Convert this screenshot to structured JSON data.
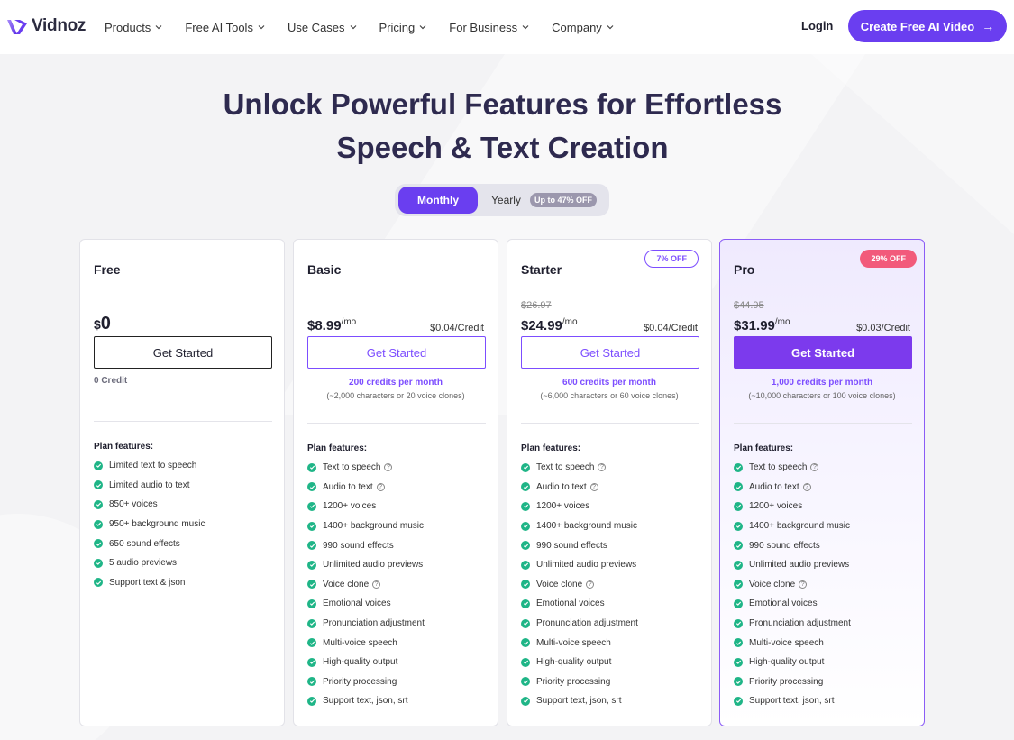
{
  "header": {
    "logo_text": "Vidnoz",
    "nav": [
      "Products",
      "Free AI Tools",
      "Use Cases",
      "Pricing",
      "For Business",
      "Company"
    ],
    "login": "Login",
    "cta": "Create Free AI Video"
  },
  "hero": {
    "title_line1": "Unlock Powerful Features for Effortless",
    "title_line2": "Speech & Text Creation"
  },
  "billing_toggle": {
    "monthly": "Monthly",
    "yearly": "Yearly",
    "yearly_badge": "Up to 47% OFF",
    "selected": "Monthly"
  },
  "plans": [
    {
      "name": "Free",
      "currency": "$",
      "price": "0",
      "button": "Get Started",
      "credit_note": "0 Credit",
      "features_label": "Plan features:",
      "features": [
        {
          "text": "Limited text to speech",
          "help": false
        },
        {
          "text": "Limited audio to text",
          "help": false
        },
        {
          "text": "850+ voices",
          "help": false
        },
        {
          "text": "950+ background music",
          "help": false
        },
        {
          "text": "650 sound effects",
          "help": false
        },
        {
          "text": "5 audio previews",
          "help": false
        },
        {
          "text": "Support text & json",
          "help": false
        }
      ]
    },
    {
      "name": "Basic",
      "price": "$8.99",
      "per": "/mo",
      "credit_rate": "$0.04/Credit",
      "button": "Get Started",
      "credits_main": "200 credits per month",
      "credits_sub": "(~2,000 characters or 20 voice clones)",
      "features_label": "Plan features:",
      "features": [
        {
          "text": "Text to speech",
          "help": true
        },
        {
          "text": "Audio to text",
          "help": true
        },
        {
          "text": "1200+ voices",
          "help": false
        },
        {
          "text": "1400+ background music",
          "help": false
        },
        {
          "text": "990 sound effects",
          "help": false
        },
        {
          "text": "Unlimited audio previews",
          "help": false
        },
        {
          "text": "Voice clone",
          "help": true
        },
        {
          "text": "Emotional voices",
          "help": false
        },
        {
          "text": "Pronunciation adjustment",
          "help": false
        },
        {
          "text": "Multi-voice speech",
          "help": false
        },
        {
          "text": "High-quality output",
          "help": false
        },
        {
          "text": "Priority processing",
          "help": false
        },
        {
          "text": "Support text, json, srt",
          "help": false
        }
      ]
    },
    {
      "name": "Starter",
      "badge": "7% OFF",
      "old_price": "$26.97",
      "price": "$24.99",
      "per": "/mo",
      "credit_rate": "$0.04/Credit",
      "button": "Get Started",
      "credits_main": "600 credits per month",
      "credits_sub": "(~6,000 characters or 60 voice clones)",
      "features_label": "Plan features:",
      "features": [
        {
          "text": "Text to speech",
          "help": true
        },
        {
          "text": "Audio to text",
          "help": true
        },
        {
          "text": "1200+ voices",
          "help": false
        },
        {
          "text": "1400+ background music",
          "help": false
        },
        {
          "text": "990 sound effects",
          "help": false
        },
        {
          "text": "Unlimited audio previews",
          "help": false
        },
        {
          "text": "Voice clone",
          "help": true
        },
        {
          "text": "Emotional voices",
          "help": false
        },
        {
          "text": "Pronunciation adjustment",
          "help": false
        },
        {
          "text": "Multi-voice speech",
          "help": false
        },
        {
          "text": "High-quality output",
          "help": false
        },
        {
          "text": "Priority processing",
          "help": false
        },
        {
          "text": "Support text, json, srt",
          "help": false
        }
      ]
    },
    {
      "name": "Pro",
      "badge": "29% OFF",
      "old_price": "$44.95",
      "price": "$31.99",
      "per": "/mo",
      "credit_rate": "$0.03/Credit",
      "button": "Get Started",
      "credits_main": "1,000 credits per month",
      "credits_sub": "(~10,000 characters or 100 voice clones)",
      "features_label": "Plan features:",
      "features": [
        {
          "text": "Text to speech",
          "help": true
        },
        {
          "text": "Audio to text",
          "help": true
        },
        {
          "text": "1200+ voices",
          "help": false
        },
        {
          "text": "1400+ background music",
          "help": false
        },
        {
          "text": "990 sound effects",
          "help": false
        },
        {
          "text": "Unlimited audio previews",
          "help": false
        },
        {
          "text": "Voice clone",
          "help": true
        },
        {
          "text": "Emotional voices",
          "help": false
        },
        {
          "text": "Pronunciation adjustment",
          "help": false
        },
        {
          "text": "Multi-voice speech",
          "help": false
        },
        {
          "text": "High-quality output",
          "help": false
        },
        {
          "text": "Priority processing",
          "help": false
        },
        {
          "text": "Support text, json, srt",
          "help": false
        }
      ]
    }
  ],
  "colors": {
    "brand": "#6a3ef0",
    "accent_text": "#7c4dff",
    "check": "#1fb587",
    "pro_badge": "#f25a7b",
    "title": "#2e2a4f"
  }
}
